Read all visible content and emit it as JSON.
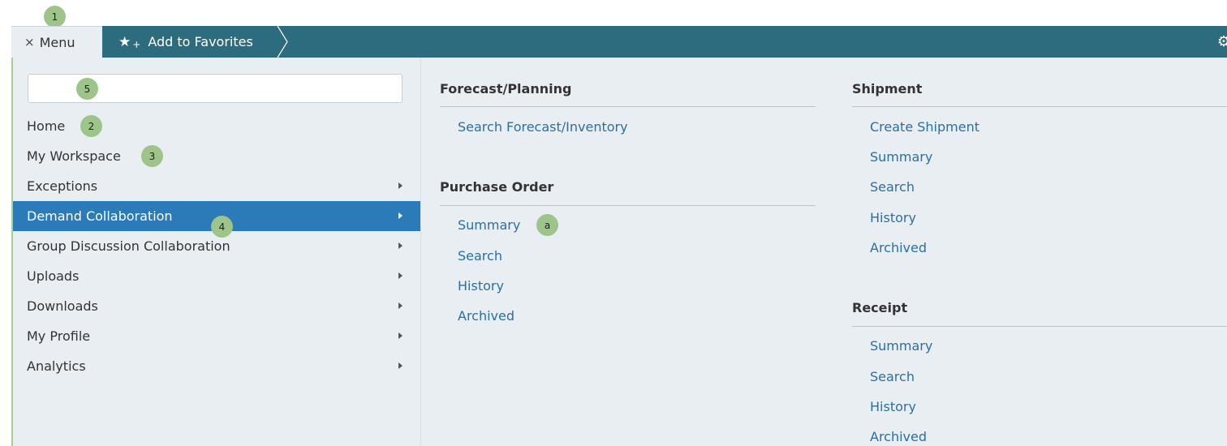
{
  "annotations": {
    "menu": "1",
    "home": "2",
    "workspace": "3",
    "demand": "4",
    "search": "5",
    "summary": "a"
  },
  "topbar": {
    "menu_label": "Menu",
    "close_icon": "×",
    "favorites_label": "Add to Favorites",
    "star_icon": "★",
    "plus_icon": "+",
    "gear_icon": "⚙"
  },
  "search": {
    "value": "",
    "placeholder": ""
  },
  "nav": {
    "items": [
      {
        "label": "Home",
        "has_submenu": false
      },
      {
        "label": "My Workspace",
        "has_submenu": false
      },
      {
        "label": "Exceptions",
        "has_submenu": true
      },
      {
        "label": "Demand Collaboration",
        "has_submenu": true,
        "active": true
      },
      {
        "label": "Group Discussion Collaboration",
        "has_submenu": true
      },
      {
        "label": "Uploads",
        "has_submenu": true
      },
      {
        "label": "Downloads",
        "has_submenu": true
      },
      {
        "label": "My Profile",
        "has_submenu": true
      },
      {
        "label": "Analytics",
        "has_submenu": true
      }
    ]
  },
  "sections": {
    "forecast": {
      "title": "Forecast/Planning",
      "links": [
        "Search Forecast/Inventory"
      ]
    },
    "purchase_order": {
      "title": "Purchase Order",
      "links": [
        "Summary",
        "Search",
        "History",
        "Archived"
      ]
    },
    "shipment": {
      "title": "Shipment",
      "links": [
        "Create Shipment",
        "Summary",
        "Search",
        "History",
        "Archived"
      ]
    },
    "receipt": {
      "title": "Receipt",
      "links": [
        "Summary",
        "Search",
        "History",
        "Archived"
      ]
    }
  },
  "colors": {
    "topbar": "#2c6c7e",
    "panel": "#e8eef2",
    "active": "#2b7bb9",
    "link": "#2a6fa8",
    "badge": "#9dc489"
  }
}
